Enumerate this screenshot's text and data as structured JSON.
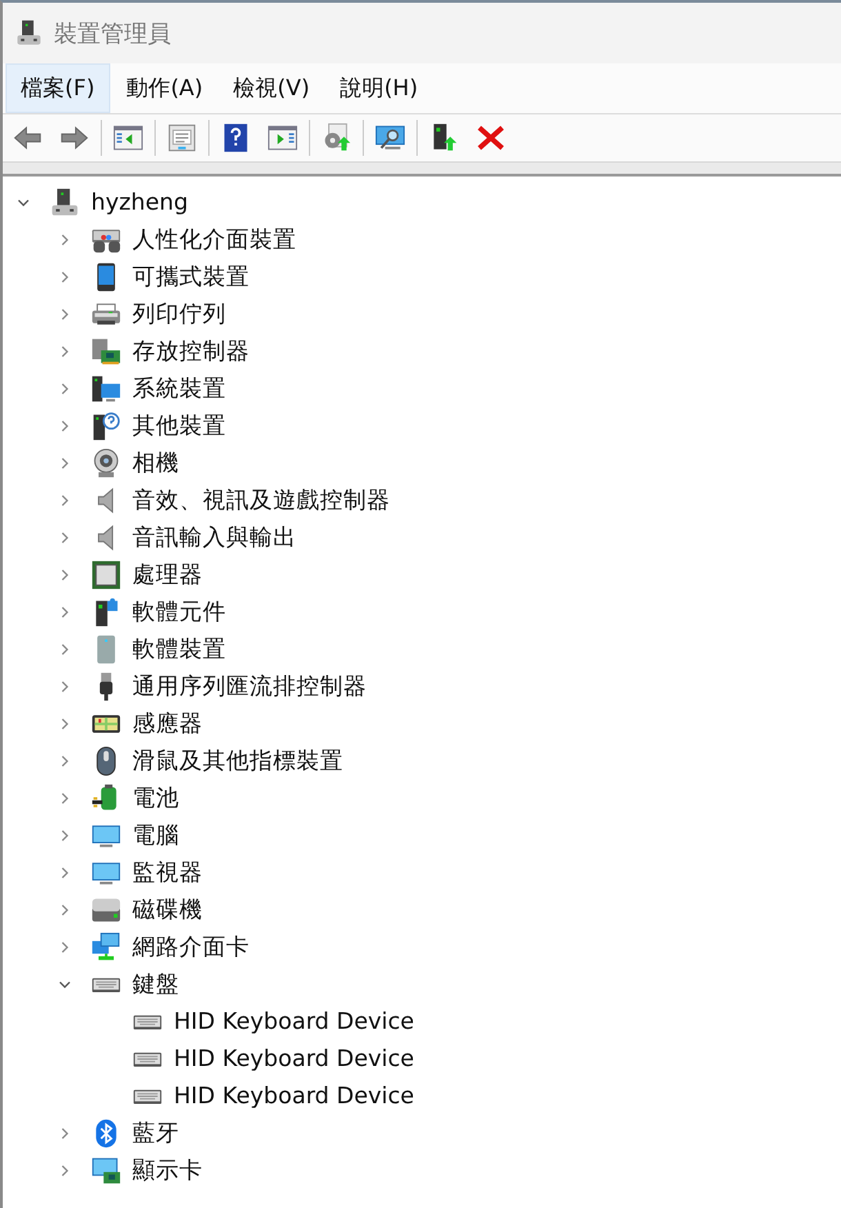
{
  "window": {
    "title": "裝置管理員"
  },
  "menu": [
    {
      "label": "檔案(F)",
      "selected": true
    },
    {
      "label": "動作(A)",
      "selected": false
    },
    {
      "label": "檢視(V)",
      "selected": false
    },
    {
      "label": "說明(H)",
      "selected": false
    }
  ],
  "toolbar": [
    {
      "kind": "back"
    },
    {
      "kind": "forward"
    },
    {
      "kind": "sep"
    },
    {
      "kind": "pane-left"
    },
    {
      "kind": "sep"
    },
    {
      "kind": "properties"
    },
    {
      "kind": "sep"
    },
    {
      "kind": "help"
    },
    {
      "kind": "pane-right"
    },
    {
      "kind": "sep"
    },
    {
      "kind": "gear-up"
    },
    {
      "kind": "sep"
    },
    {
      "kind": "scan"
    },
    {
      "kind": "sep"
    },
    {
      "kind": "tower-up"
    },
    {
      "kind": "remove"
    }
  ],
  "tree": [
    {
      "label": "hyzheng",
      "kind": "tower",
      "expanded": true,
      "children": [
        {
          "label": "人性化介面裝置",
          "kind": "hid",
          "expanded": false
        },
        {
          "label": "可攜式裝置",
          "kind": "tablet",
          "expanded": false
        },
        {
          "label": "列印佇列",
          "kind": "printer",
          "expanded": false
        },
        {
          "label": "存放控制器",
          "kind": "storage",
          "expanded": false
        },
        {
          "label": "系統裝置",
          "kind": "system",
          "expanded": false
        },
        {
          "label": "其他裝置",
          "kind": "other",
          "expanded": false
        },
        {
          "label": "相機",
          "kind": "camera",
          "expanded": false
        },
        {
          "label": "音效、視訊及遊戲控制器",
          "kind": "speaker",
          "expanded": false
        },
        {
          "label": "音訊輸入與輸出",
          "kind": "speaker",
          "expanded": false
        },
        {
          "label": "處理器",
          "kind": "chip",
          "expanded": false
        },
        {
          "label": "軟體元件",
          "kind": "softcomp",
          "expanded": false
        },
        {
          "label": "軟體裝置",
          "kind": "softdev",
          "expanded": false
        },
        {
          "label": "通用序列匯流排控制器",
          "kind": "usb",
          "expanded": false
        },
        {
          "label": "感應器",
          "kind": "sensor",
          "expanded": false
        },
        {
          "label": "滑鼠及其他指標裝置",
          "kind": "mouse",
          "expanded": false
        },
        {
          "label": "電池",
          "kind": "battery",
          "expanded": false
        },
        {
          "label": "電腦",
          "kind": "monitor",
          "expanded": false
        },
        {
          "label": "監視器",
          "kind": "monitor",
          "expanded": false
        },
        {
          "label": "磁碟機",
          "kind": "drive",
          "expanded": false
        },
        {
          "label": "網路介面卡",
          "kind": "network",
          "expanded": false
        },
        {
          "label": "鍵盤",
          "kind": "keyboard",
          "expanded": true,
          "children": [
            {
              "label": "HID Keyboard Device",
              "kind": "keyboard"
            },
            {
              "label": "HID Keyboard Device",
              "kind": "keyboard"
            },
            {
              "label": "HID Keyboard Device",
              "kind": "keyboard"
            }
          ]
        },
        {
          "label": "藍牙",
          "kind": "bluetooth",
          "expanded": false
        },
        {
          "label": "顯示卡",
          "kind": "display",
          "expanded": false
        }
      ]
    }
  ]
}
